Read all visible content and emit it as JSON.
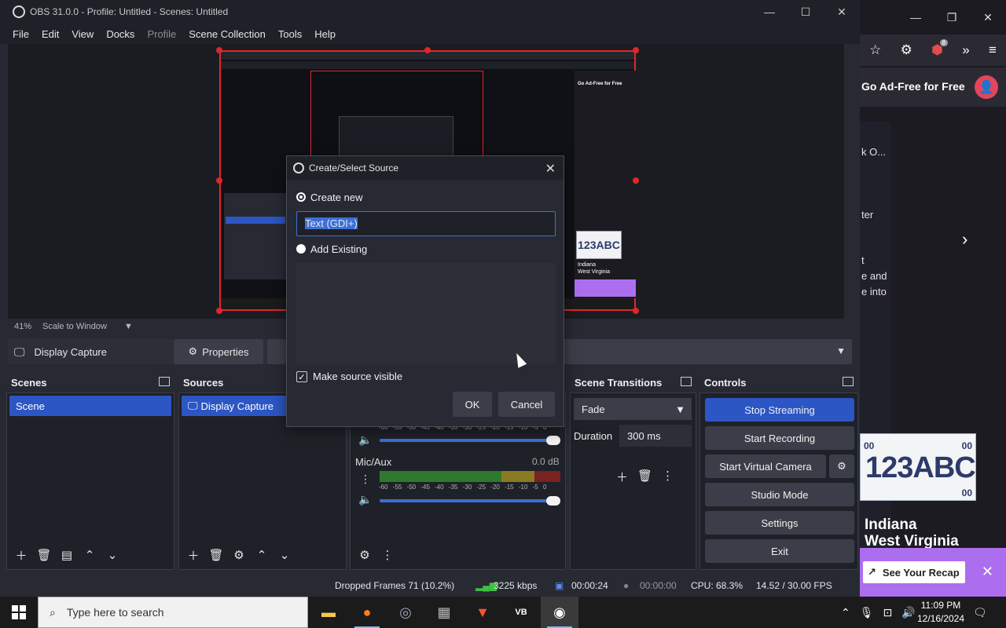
{
  "obs": {
    "title": "OBS 31.0.0 - Profile: Untitled - Scenes: Untitled",
    "menu": [
      "File",
      "Edit",
      "View",
      "Docks",
      "Profile",
      "Scene Collection",
      "Tools",
      "Help"
    ],
    "zoom": "41%",
    "scale_mode": "Scale to Window",
    "source_name": "Display Capture",
    "properties_label": "Properties",
    "docks": {
      "scenes": {
        "title": "Scenes",
        "items": [
          "Scene"
        ]
      },
      "sources": {
        "title": "Sources",
        "items": [
          "Display Capture"
        ]
      },
      "transitions": {
        "title": "Scene Transitions",
        "selected": "Fade",
        "duration_label": "Duration",
        "duration_value": "300 ms"
      },
      "controls": {
        "title": "Controls",
        "stop_streaming": "Stop Streaming",
        "start_recording": "Start Recording",
        "start_virtual_camera": "Start Virtual Camera",
        "studio_mode": "Studio Mode",
        "settings": "Settings",
        "exit": "Exit"
      }
    },
    "mixer": {
      "mic_label": "Mic/Aux",
      "mic_level": "0.0 dB",
      "scale": "-60 -55 -50 -45 -40 -35 -30 -25 -20 -15 -10 -5 0"
    },
    "status": {
      "dropped_frames": "Dropped Frames 71 (10.2%)",
      "bitrate": "3225 kbps",
      "stream_time": "00:00:24",
      "record_time": "00:00:00",
      "cpu": "CPU: 68.3%",
      "fps": "14.52 / 30.00 FPS"
    }
  },
  "dialog": {
    "title": "Create/Select Source",
    "create_new": "Create new",
    "name_value": "Text (GDI+)",
    "add_existing": "Add Existing",
    "make_visible": "Make source visible",
    "ok": "OK",
    "cancel": "Cancel"
  },
  "browser": {
    "badge_count": "8",
    "ad_free": "Go Ad-Free for Free",
    "snippet_1": "k O...",
    "snippet_2": "ter",
    "snippet_3": "t",
    "snippet_4": "e and",
    "snippet_5": "e into",
    "plate_number": "123ABC",
    "plate_code": "00",
    "state_1": "Indiana",
    "state_2": "West Virginia",
    "recap": "See Your Recap"
  },
  "taskbar": {
    "search_placeholder": "Type here to search",
    "time": "11:09 PM",
    "date": "12/16/2024"
  }
}
